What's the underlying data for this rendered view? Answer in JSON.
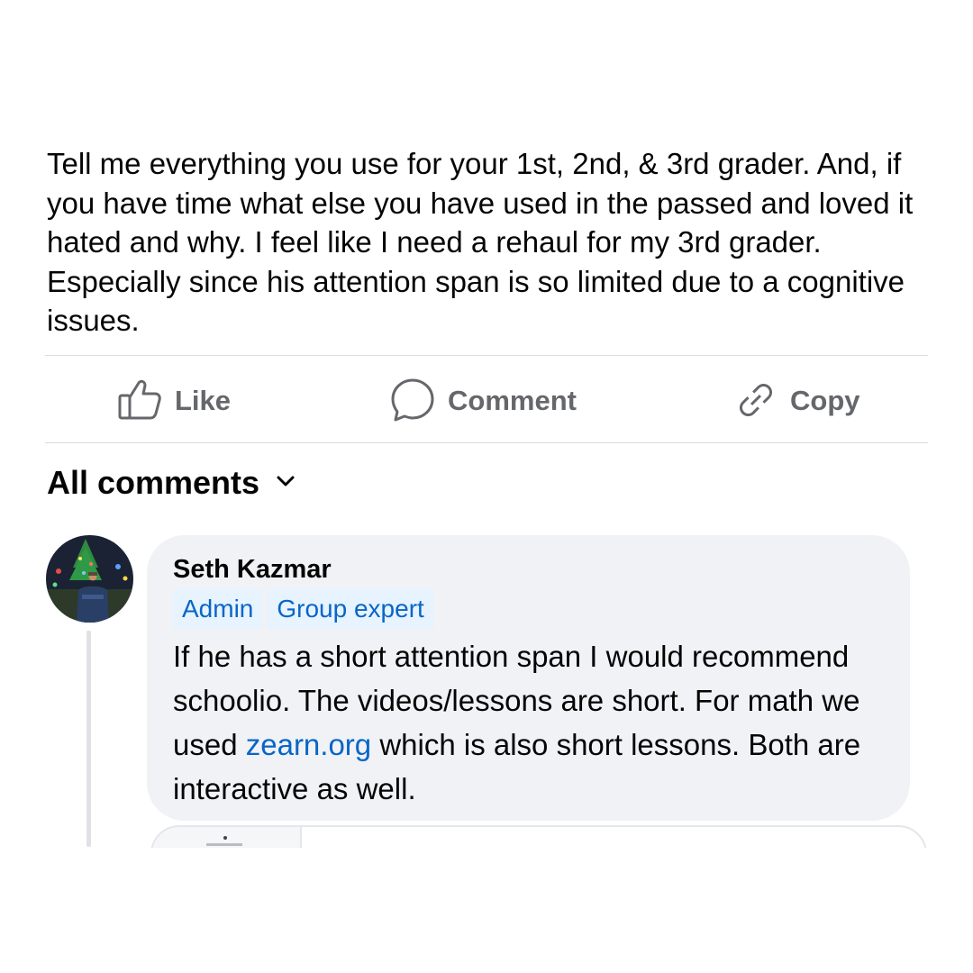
{
  "post": {
    "text": "Tell me everything you use for your 1st, 2nd, & 3rd grader. And, if you have time what else you have used in the passed and loved it hated and why. I feel like I need a rehaul for my 3rd grader. Especially since his attention span is so limited due to a cognitive issues."
  },
  "actions": {
    "like_label": "Like",
    "comment_label": "Comment",
    "copy_label": "Copy"
  },
  "comments_header": {
    "title": "All comments",
    "dropdown_icon": "chevron-down-icon"
  },
  "comment": {
    "author": "Seth Kazmar",
    "badges": [
      "Admin",
      "Group expert"
    ],
    "text_before_link": "If he has a short attention span I would recommend schoolio. The videos/lessons are short. For math we used ",
    "link_text": "zearn.org",
    "text_after_link": " which is also short lessons. Both are interactive as well."
  },
  "colors": {
    "text": "#050505",
    "secondary_text": "#65676b",
    "link": "#0866c6",
    "badge_bg": "#e7f3ff",
    "bubble_bg": "#f0f2f5",
    "divider": "#dadde1"
  }
}
